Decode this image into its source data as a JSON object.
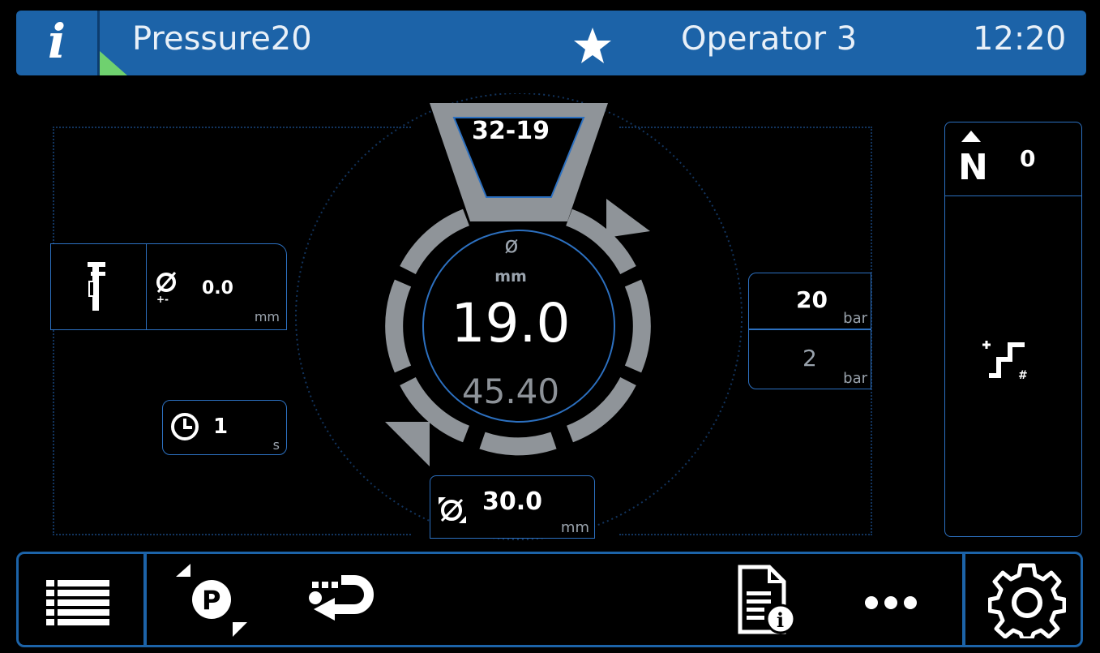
{
  "header": {
    "info_label": "i",
    "program_name": "Pressure20",
    "operator": "Operator 3",
    "time": "12:20"
  },
  "left_panel": {
    "diameter_tolerance": {
      "value": "0.0",
      "unit": "mm"
    },
    "timer": {
      "value": "1",
      "unit": "s"
    }
  },
  "gauge": {
    "code": "32-19",
    "diameter_symbol": "ø",
    "diameter_unit": "mm",
    "main_value": "19.0",
    "secondary_value": "45.40",
    "outer_diameter": {
      "value": "30.0",
      "unit": "mm"
    }
  },
  "pressure": {
    "high": {
      "value": "20",
      "unit": "bar"
    },
    "low": {
      "value": "2",
      "unit": "bar"
    }
  },
  "counter": {
    "value": "0"
  },
  "toolbar": {
    "icons": [
      "list-icon",
      "program-switch-icon",
      "transfer-icon",
      "document-info-icon",
      "more-icon",
      "gear-icon"
    ]
  },
  "colors": {
    "header_bg": "#1c63a8",
    "border": "#2c70c0",
    "gauge_ring": "#8f9499",
    "accent_green": "#6fd16f"
  }
}
